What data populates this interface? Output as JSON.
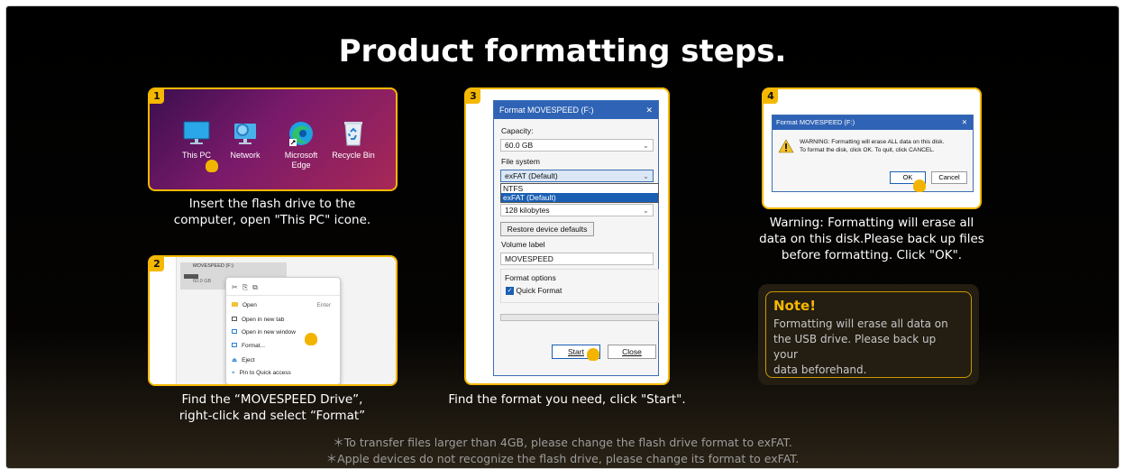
{
  "title": "Product formatting steps.",
  "step1": {
    "badge": "1",
    "icons": [
      {
        "label": "This PC",
        "icon": "monitor-icon"
      },
      {
        "label": "Network",
        "icon": "network-icon"
      },
      {
        "label": "Microsoft Edge",
        "icon": "edge-icon"
      },
      {
        "label": "Recycle Bin",
        "icon": "recycle-bin-icon"
      }
    ],
    "caption_line1": "Insert the flash drive to the",
    "caption_line2": "computer, open \"This PC\" icone."
  },
  "step2": {
    "badge": "2",
    "drive_name": "MOVESPEED (F:)",
    "drive_size": "60.0 GB",
    "menu": [
      {
        "label": "Open",
        "shortcut": "Enter"
      },
      {
        "label": "Open in new tab",
        "shortcut": ""
      },
      {
        "label": "Open in new window",
        "shortcut": ""
      },
      {
        "label": "Format...",
        "shortcut": ""
      },
      {
        "label": "Eject",
        "shortcut": ""
      },
      {
        "label": "Pin to Quick access",
        "shortcut": ""
      }
    ],
    "caption_line1": "Find the “MOVESPEED Drive”,",
    "caption_line2": "right-click and select “Format”"
  },
  "step3": {
    "badge": "3",
    "dialog_title": "Format MOVESPEED (F:)",
    "close": "✕",
    "capacity_label": "Capacity:",
    "capacity_value": "60.0 GB",
    "fs_label": "File system",
    "fs_value": "exFAT (Default)",
    "fs_options": [
      "NTFS",
      "exFAT (Default)"
    ],
    "alloc_value": "128 kilobytes",
    "restore": "Restore device defaults",
    "volume_label": "Volume label",
    "volume_value": "MOVESPEED",
    "options_label": "Format options",
    "quick_format": "Quick Format",
    "start": "Start",
    "close_btn": "Close",
    "caption": "Find the format you need, click \"Start\"."
  },
  "step4": {
    "badge": "4",
    "dialog_title": "Format MOVESPEED (F:)",
    "close": "✕",
    "warn_line1": "WARNING: Formatting will erase ALL data on this disk.",
    "warn_line2": "To format the disk, click OK. To quit, click CANCEL.",
    "ok": "OK",
    "cancel": "Cancel",
    "caption_line1": "Warning: Formatting will erase all",
    "caption_line2": "data on this disk.Please back up files",
    "caption_line3": "before formatting. Click \"OK\"."
  },
  "note": {
    "title": "Note!",
    "line1": "Formatting will erase all data on",
    "line2": "the USB drive. Please back up your",
    "line3": "data beforehand."
  },
  "footer": {
    "line1": "＊To transfer files larger than 4GB, please change the flash drive format to exFAT.",
    "line2": "＊Apple devices do not recognize the flash drive, please change its format to exFAT."
  },
  "colors": {
    "accent": "#f5b800",
    "dialog_blue": "#2f63b5",
    "selection": "#1a5fb4"
  }
}
